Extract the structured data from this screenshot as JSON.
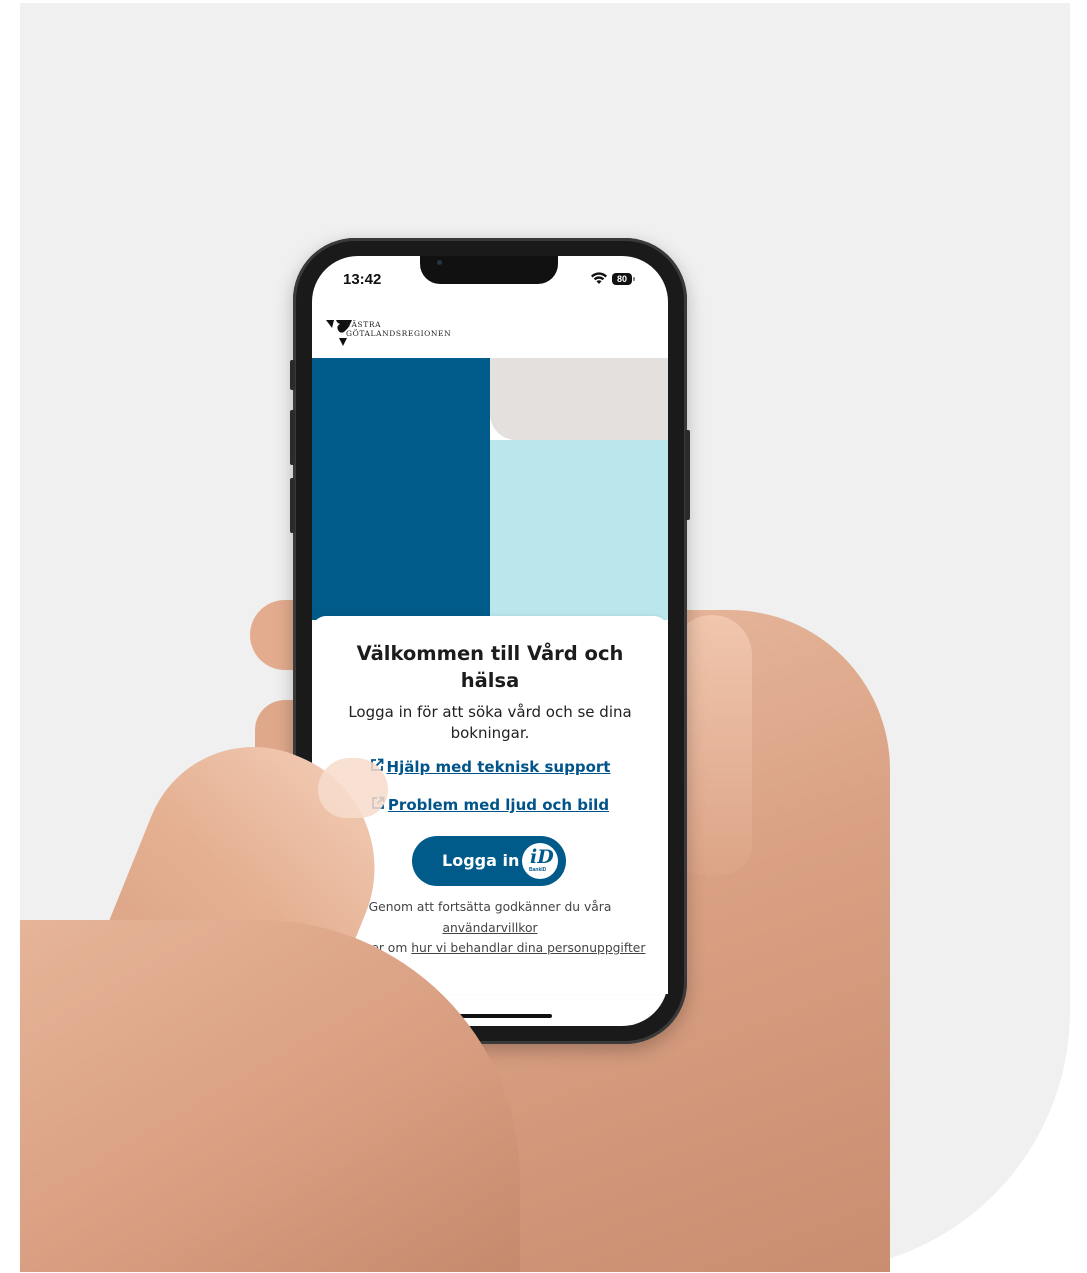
{
  "status_bar": {
    "time": "13:42",
    "battery": "80"
  },
  "logo": {
    "line1": "VÄSTRA",
    "line2": "GÖTALANDSREGIONEN"
  },
  "welcome": {
    "title": "Välkommen till Vård och hälsa",
    "subtitle": "Logga in för att söka vård och se dina bokningar."
  },
  "links": [
    {
      "label": "Hjälp med teknisk support",
      "icon": "external-link-icon"
    },
    {
      "label": "Problem med ljud och bild",
      "icon": "external-link-icon"
    }
  ],
  "login": {
    "label": "Logga in",
    "icon": "bankid-icon",
    "bankid_text": "BankID"
  },
  "terms": {
    "prefix": "Genom att fortsätta godkänner du våra",
    "terms_link": "användarvillkor",
    "more_prefix": "Läs mer om",
    "privacy_link": "hur vi behandlar dina personuppgifter"
  },
  "colors": {
    "brand_dark": "#005b8a",
    "brand_light": "#b9e7ec",
    "beige": "#e3e0dd"
  }
}
